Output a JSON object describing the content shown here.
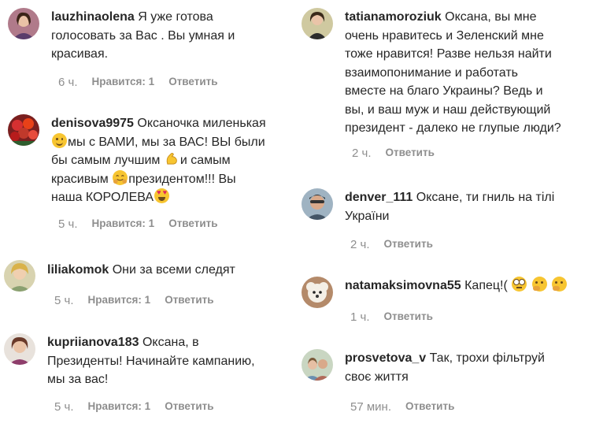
{
  "left_column": [
    {
      "username": "lauzhinaolena",
      "lines": [
        "Я уже готова",
        "голосовать за Вас . Вы умная и",
        "красивая."
      ],
      "time": "6 ч.",
      "likes": "Нравится: 1",
      "reply": "Ответить",
      "avatar_icon": "user-photo-icon"
    },
    {
      "username": "denisova9975",
      "line1": "Оксаночка миленькая",
      "line2_after_emoji": "мы с ВАМИ, мы за ВАС! ВЫ были",
      "line3_before_emoji": "бы самым лучшим",
      "line3_after_emoji": "и самым",
      "line4_before_emoji": "красивым",
      "line4_after_emoji": "президентом!!! Вы",
      "line5_before_emoji": "наша КОРОЛЕВА",
      "emojis": [
        "smile-emoji",
        "muscle-emoji",
        "hug-emoji",
        "heart-eyes-emoji"
      ],
      "time": "5 ч.",
      "likes": "Нравится: 1",
      "reply": "Ответить",
      "avatar_icon": "roses-photo-icon"
    },
    {
      "username": "liliakomok",
      "lines": [
        "Они за всеми следят"
      ],
      "time": "5 ч.",
      "likes": "Нравится: 1",
      "reply": "Ответить",
      "avatar_icon": "user-photo-icon"
    },
    {
      "username": "kupriianova183",
      "lines": [
        "Оксана, в",
        "Президенты! Начинайте кампанию,",
        "мы за вас!"
      ],
      "time": "5 ч.",
      "likes": "Нравится: 1",
      "reply": "Ответить",
      "avatar_icon": "user-photo-icon"
    }
  ],
  "right_column": [
    {
      "username": "tatianamoroziuk",
      "lines": [
        "Оксана, вы мне",
        "очень нравитесь и Зеленский мне",
        "тоже нравится! Разве нельзя найти",
        "взаимопонимание и работать",
        "вместе на благо Украины? Ведь и",
        "вы, и ваш муж и наш действующий",
        "президент - далеко не глупые люди?"
      ],
      "time": "2 ч.",
      "reply": "Ответить",
      "avatar_icon": "user-photo-icon"
    },
    {
      "username": "denver_111",
      "lines": [
        "Оксане, ти гниль на тілі",
        "України"
      ],
      "time": "2 ч.",
      "reply": "Ответить",
      "avatar_icon": "user-photo-icon"
    },
    {
      "username": "natamaksimovna55",
      "lines": [
        "Капец!("
      ],
      "emojis": [
        "eye-roll-emoji",
        "thinking-emoji",
        "thinking-emoji"
      ],
      "time": "1 ч.",
      "reply": "Ответить",
      "avatar_icon": "dog-photo-icon"
    },
    {
      "username": "prosvetova_v",
      "lines": [
        "Так, трохи фільтруй",
        "своє життя"
      ],
      "time": "57 мин.",
      "reply": "Ответить",
      "avatar_icon": "user-photo-icon"
    }
  ]
}
